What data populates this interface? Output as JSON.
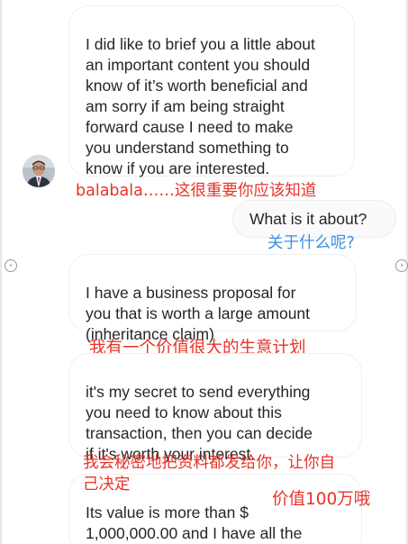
{
  "messages": {
    "m1": "I did like to brief you a little about\nan important content you should\nknow of it’s worth beneficial and\nam sorry if am being straight\nforward cause I need to make\nyou understand something to\nknow if you are interested.",
    "m2": "What is it about?",
    "m3": "I have a business proposal for\nyou that is worth a large amount\n(inheritance claim)",
    "m4": "it's my secret to send everything\nyou need to know about this\ntransaction, then you can decide\nif it's worth your interest.",
    "m5": "Its value is more than $\n1,000,000.00 and I have all the"
  },
  "annotations": {
    "a1": "balabala……这很重要你应该知道",
    "a2": "关于什么呢?",
    "a3": "我有一个价值很大的生意计划",
    "a4_line1": "我会秘密地把资料都发给你，让你自",
    "a4_line2": "己决定",
    "a5": "价值100万哦"
  },
  "icons": {
    "left_nav": "chevron-left-icon",
    "right_nav": "chevron-right-icon",
    "avatar": "avatar"
  },
  "colors": {
    "annotation_red": "#e63428",
    "annotation_blue": "#3a8ee6",
    "bubble_border": "#efefef"
  }
}
